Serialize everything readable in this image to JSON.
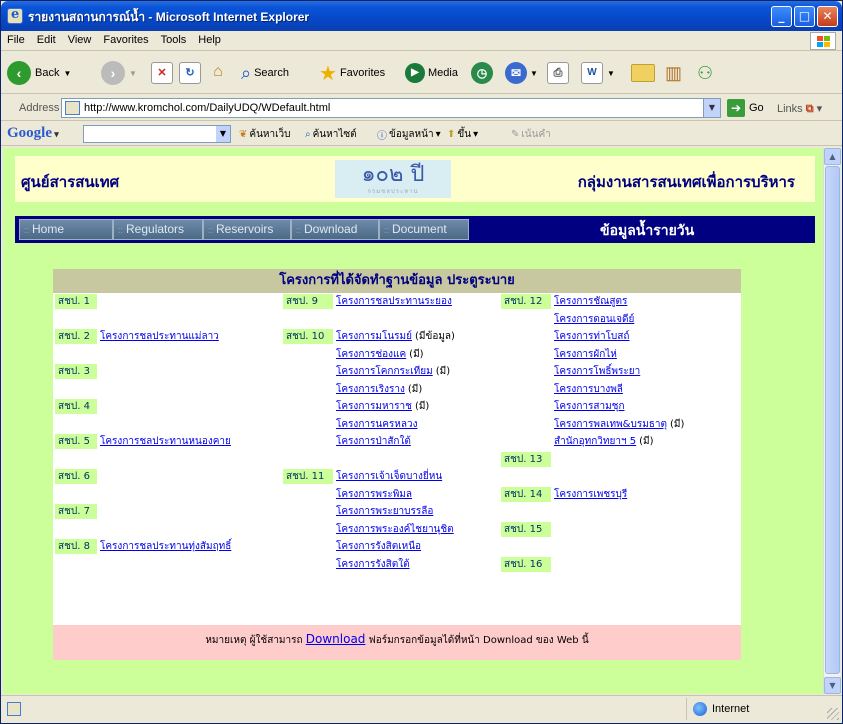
{
  "window": {
    "title": "รายงานสถานการณ์น้ำ - Microsoft Internet Explorer"
  },
  "menubar": {
    "items": [
      "File",
      "Edit",
      "View",
      "Favorites",
      "Tools",
      "Help"
    ]
  },
  "toolbar": {
    "back_label": "Back",
    "search_label": "Search",
    "favorites_label": "Favorites",
    "media_label": "Media"
  },
  "address": {
    "label": "Address",
    "url": "http://www.kromchol.com/DailyUDQ/WDefault.html",
    "go_label": "Go",
    "links_label": "Links"
  },
  "googlebar": {
    "logo": "Google",
    "search_web": "ค้นหาเว็บ",
    "search_site": "ค้นหาไซต์",
    "page_info": "ข้อมูลหน้า",
    "up": "ขึ้น",
    "highlight": "เน้นคำ"
  },
  "page": {
    "header_left": "ศูนย์สารสนเทศ",
    "header_logo": "๑๐๒ ปี",
    "header_logo_sub": "กรมชลประทาน",
    "header_right": "กลุ่มงานสารสนเทศเพื่อการบริหาร",
    "nav": [
      "Home",
      "Regulators",
      "Reservoirs",
      "Download",
      "Document"
    ],
    "nav_title": "ข้อมูลน้ำรายวัน",
    "table_title": "โครงการที่ได้จัดทำฐานข้อมูล ประตูระบาย",
    "col1": [
      {
        "label": "สชป. 1",
        "projects": []
      },
      {
        "label": "สชป. 2",
        "projects": [
          {
            "name": "โครงการชลประทานแม่ลาว",
            "note": ""
          }
        ]
      },
      {
        "label": "สชป. 3",
        "projects": []
      },
      {
        "label": "สชป. 4",
        "projects": []
      },
      {
        "label": "สชป. 5",
        "projects": [
          {
            "name": "โครงการชลประทานหนองคาย",
            "note": ""
          }
        ]
      },
      {
        "label": "สชป. 6",
        "projects": []
      },
      {
        "label": "สชป. 7",
        "projects": []
      },
      {
        "label": "สชป. 8",
        "projects": [
          {
            "name": "โครงการชลประทานทุ่งสัมฤทธิ์",
            "note": ""
          }
        ]
      }
    ],
    "col2": [
      {
        "label": "สชป. 9",
        "projects": [
          {
            "name": "โครงการชลประทานระยอง",
            "note": ""
          }
        ]
      },
      {
        "label": "สชป. 10",
        "projects": [
          {
            "name": "โครงการมโนรมย์",
            "note": "(มีข้อมูล)"
          },
          {
            "name": "โครงการช่องแค",
            "note": "(มี)"
          },
          {
            "name": "โครงการโคกกระเทียม",
            "note": "(มี)"
          },
          {
            "name": "โครงการเริงราง",
            "note": "(มี)"
          },
          {
            "name": "โครงการมหาราช",
            "note": "(มี)"
          },
          {
            "name": "โครงการนครหลวง",
            "note": ""
          },
          {
            "name": "โครงการป่าสักใต้",
            "note": ""
          }
        ]
      },
      {
        "label": "สชป. 11",
        "projects": [
          {
            "name": "โครงการเจ้าเจ็ดบางยี่หน",
            "note": ""
          },
          {
            "name": "โครงการพระพิมล",
            "note": ""
          },
          {
            "name": "โครงการพระยาบรรลือ",
            "note": ""
          },
          {
            "name": "โครงการพระองค์ไชยานุชิต",
            "note": ""
          },
          {
            "name": "โครงการรังสิตเหนือ",
            "note": ""
          },
          {
            "name": "โครงการรังสิตใต้",
            "note": ""
          }
        ]
      }
    ],
    "col3": [
      {
        "label": "สชป. 12",
        "projects": [
          {
            "name": "โครงการชัณสูตร",
            "note": ""
          },
          {
            "name": "โครงการดอนเจดีย์",
            "note": ""
          },
          {
            "name": "โครงการท่าโบสถ์",
            "note": ""
          },
          {
            "name": "โครงการผักไห่",
            "note": ""
          },
          {
            "name": "โครงการโพธิ์พระยา",
            "note": ""
          },
          {
            "name": "โครงการบางพลี",
            "note": ""
          },
          {
            "name": "โครงการสามชุก",
            "note": ""
          },
          {
            "name": "โครงการพลเทพ&บรมธาตุ",
            "note": "(มี)"
          },
          {
            "name": "สำนักอุทกวิทยาฯ 5",
            "note": "(มี)"
          }
        ]
      },
      {
        "label": "สชป. 13",
        "projects": []
      },
      {
        "label": "สชป. 14",
        "projects": [
          {
            "name": "โครงการเพชรบุรี",
            "note": ""
          }
        ]
      },
      {
        "label": "สชป. 15",
        "projects": []
      },
      {
        "label": "สชป. 16",
        "projects": []
      }
    ],
    "footer_prefix": "หมายเหตุ ผู้ใช้สามารถ",
    "footer_link": "Download",
    "footer_suffix": "ฟอร์มกรอกข้อมูลได้ที่หน้า Download ของ Web นี้"
  },
  "status": {
    "zone": "Internet"
  }
}
